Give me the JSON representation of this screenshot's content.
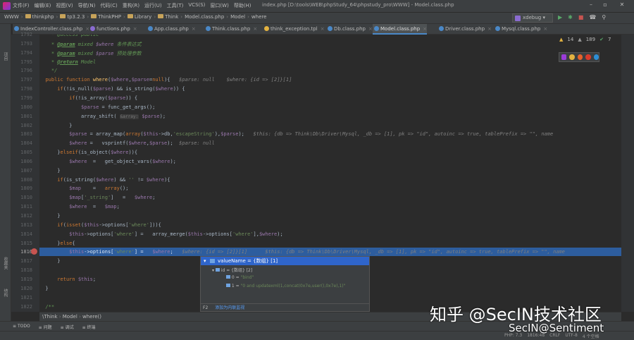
{
  "titlebar": {
    "menu": [
      "文件(F)",
      "编辑(E)",
      "视图(V)",
      "导航(N)",
      "代码(C)",
      "重构(R)",
      "运行(U)",
      "工具(T)",
      "VCS(S)",
      "窗口(W)",
      "帮助(H)"
    ],
    "title": "index.php [D:\\tools\\WEB\\phpStudy_64\\phpstudy_pro\\WWW] - Model.class.php"
  },
  "navbar": {
    "crumbs": [
      "WWW",
      "thinkphp",
      "tp3.2.3",
      "ThinkPHP",
      "Library",
      "Think",
      "Model.class.php",
      "Model",
      "where"
    ],
    "run_config": "xdebug"
  },
  "tabs": [
    "IndexController.class.php",
    "functions.php",
    "App.class.php",
    "Think.class.php",
    "think_exception.tpl",
    "Db.class.php",
    "Model.class.php",
    "Driver.class.php",
    "Mysql.class.php"
  ],
  "active_tab": "Model.class.php",
  "inspections": {
    "warnings": "14",
    "weak": "189",
    "typos": "7"
  },
  "left_stripe": [
    "项目",
    "收藏夹",
    "结构"
  ],
  "lines": [
    {
      "n": "1792",
      "html": "    <span class=\"cm\">* @access public</span>"
    },
    {
      "n": "1793",
      "html": "    <span class=\"cm\">* <span class=\"tg\">@param</span> mixed <span class=\"vr\">$where</span> 条件表达式</span>"
    },
    {
      "n": "1794",
      "html": "    <span class=\"cm\">* <span class=\"tg\">@param</span> mixed <span class=\"vr\">$parse</span> 预处理参数</span>"
    },
    {
      "n": "1795",
      "html": "    <span class=\"cm\">* <span class=\"tg\">@return</span> Model</span>"
    },
    {
      "n": "1796",
      "html": "    <span class=\"cm\">*/</span>"
    },
    {
      "n": "1797",
      "html": "  <span class=\"kw\">public function</span> <span class=\"fn\">where</span>(<span class=\"vr\">$where</span>,<span class=\"vr\">$parse</span>=<span class=\"kw\">null</span>){   <span class=\"dim\">$parse: null    $where: {id => [2]}[1]</span>"
    },
    {
      "n": "1798",
      "html": "      <span class=\"kw\">if</span>(!is_null(<span class=\"vr\">$parse</span>) && is_string(<span class=\"vr\">$where</span>)) {"
    },
    {
      "n": "1799",
      "html": "          <span class=\"kw\">if</span>(!is_array(<span class=\"vr\">$parse</span>)) {"
    },
    {
      "n": "1800",
      "html": "              <span class=\"vr\">$parse</span> = func_get_args();"
    },
    {
      "n": "1801",
      "html": "              array_shift( <span class=\"hint\">&amp;array:</span> <span class=\"vr\">$parse</span>);"
    },
    {
      "n": "1802",
      "html": "          }"
    },
    {
      "n": "1803",
      "html": "          <span class=\"vr\">$parse</span> = array_map(<span class=\"kw\">array</span>(<span class=\"vr\">$this</span>->db,<span class=\"st\">'escapeString'</span>),<span class=\"vr\">$parse</span>);   <span class=\"dim\">$this: {db => Think\\Db\\Driver\\Mysql, _db => [1], pk => \"id\", autoinc => true, tablePrefix => \"\", name</span>"
    },
    {
      "n": "1804",
      "html": "          <span class=\"vr\">$where</span> =   vsprintf(<span class=\"vr\">$where</span>,<span class=\"vr\">$parse</span>);  <span class=\"dim\">$parse: null</span>"
    },
    {
      "n": "1805",
      "html": "      }<span class=\"kw\">elseif</span>(is_object(<span class=\"vr\">$where</span>)){"
    },
    {
      "n": "1806",
      "html": "          <span class=\"vr\">$where</span>  =   get_object_vars(<span class=\"vr\">$where</span>);"
    },
    {
      "n": "1807",
      "html": "      }"
    },
    {
      "n": "1808",
      "html": "      <span class=\"kw\">if</span>(is_string(<span class=\"vr\">$where</span>) && <span class=\"st\">''</span> != <span class=\"vr\">$where</span>){"
    },
    {
      "n": "1809",
      "html": "          <span class=\"vr\">$map</span>    =   <span class=\"kw\">array</span>();"
    },
    {
      "n": "1810",
      "html": "          <span class=\"vr\">$map</span>[<span class=\"st\">'_string'</span>]   =   <span class=\"vr\">$where</span>;"
    },
    {
      "n": "1811",
      "html": "          <span class=\"vr\">$where</span>  =   <span class=\"vr\">$map</span>;"
    },
    {
      "n": "1812",
      "html": "      }"
    },
    {
      "n": "1813",
      "html": "      <span class=\"kw\">if</span>(<span class=\"kw\">isset</span>(<span class=\"vr\">$this</span>->options[<span class=\"st\">'where'</span>])){"
    },
    {
      "n": "1814",
      "html": "          <span class=\"vr\">$this</span>->options[<span class=\"st\">'where'</span>] =   array_merge(<span class=\"vr\">$this</span>->options[<span class=\"st\">'where'</span>],<span class=\"vr\">$where</span>);"
    },
    {
      "n": "1815",
      "html": "      }<span class=\"kw\">else</span>{"
    },
    {
      "n": "1816",
      "html": "          <span class=\"vr\">$this</span>->options[<span class=\"st\">'where'</span>] =   <span class=\"vr\">$where</span>;   <span class=\"dim\">$where: {id => [2]}[1]</span>      <span class=\"dim\">$this: {db => Think\\Db\\Driver\\Mysql, _db => [1], pk => \"id\", autoinc => true, tablePrefix => \"\", name</span>"
    },
    {
      "n": "1817",
      "html": "      }"
    },
    {
      "n": "1818",
      "html": ""
    },
    {
      "n": "1819",
      "html": "      <span class=\"kw\">return</span> <span class=\"vr\">$this</span>;"
    },
    {
      "n": "1820",
      "html": "  }"
    },
    {
      "n": "1821",
      "html": ""
    },
    {
      "n": "1822",
      "html": "  <span class=\"cm\">/**</span>"
    }
  ],
  "current_line": "1816",
  "popup": {
    "head": "valueName = {数组} [1]",
    "id_row": "id = {数组} [2]",
    "items": [
      {
        "k": "0",
        "v": "\"bind\""
      },
      {
        "k": "1",
        "v": "\"0 and updatexml(1,concat(0x7e,user(),0x7e),1)\""
      }
    ],
    "foot_key": "F2",
    "foot_link": "添加为内联监视"
  },
  "breadcrumb2": [
    "\\Think",
    "Model",
    "where()"
  ],
  "bottom_tools": [
    "TODO",
    "问题",
    "调试",
    "终端"
  ],
  "status": [
    "PHP: 7.3",
    "1816:48",
    "CRLF",
    "UTF-8",
    "4 个空格"
  ],
  "watermark": {
    "line1": "知乎 @SecIN技术社区",
    "line2": "SecIN@Sentiment"
  }
}
